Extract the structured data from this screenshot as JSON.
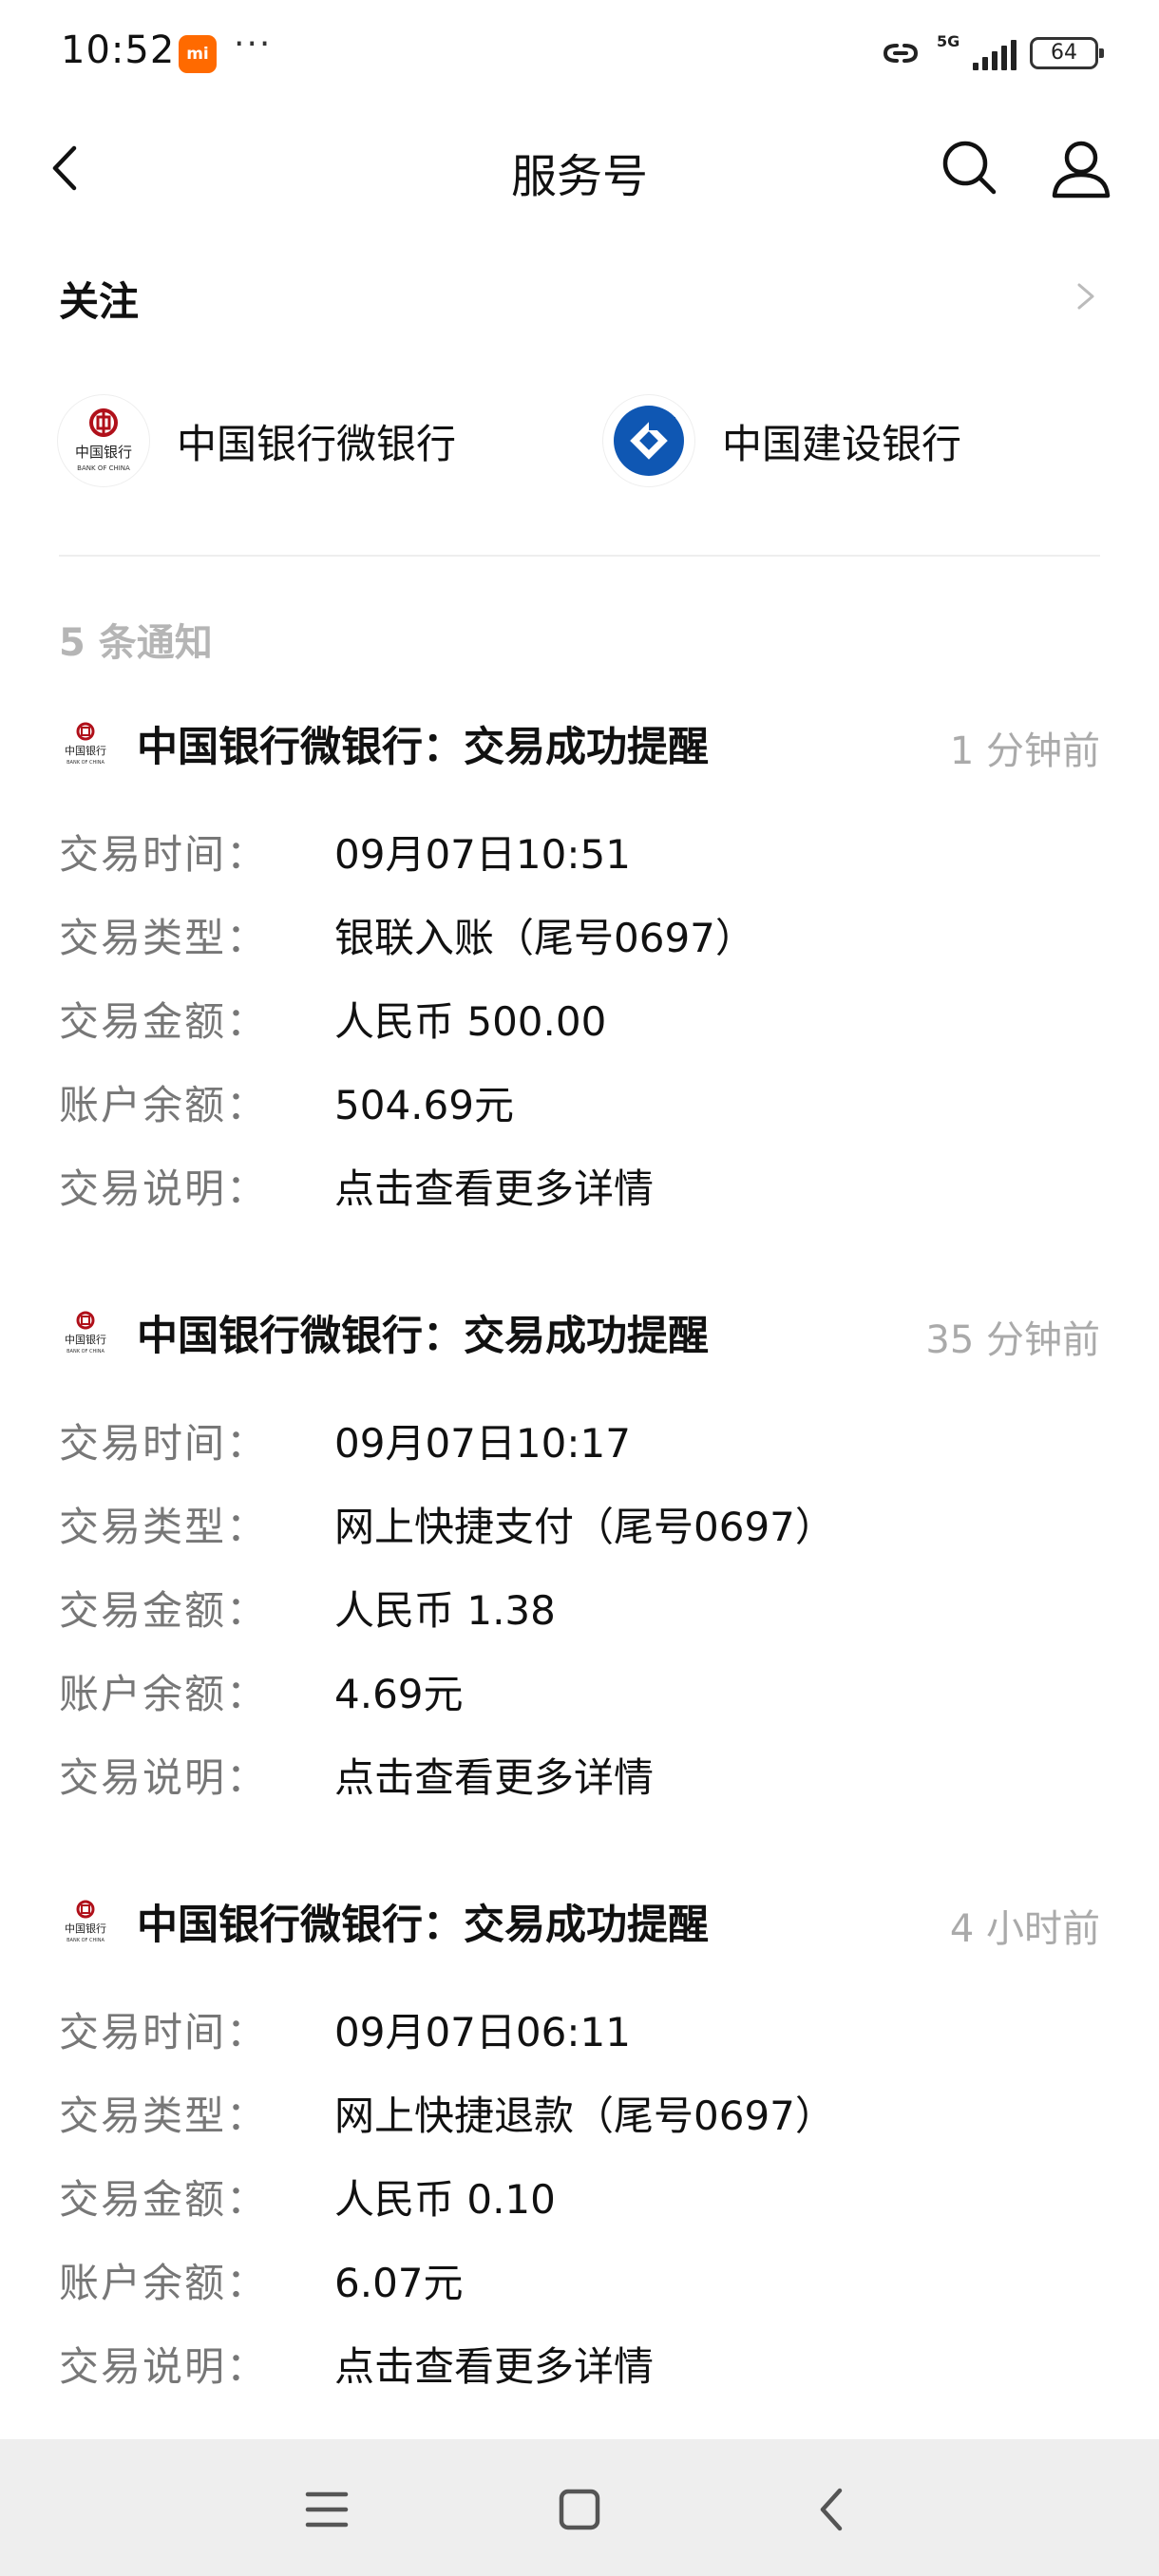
{
  "status_bar": {
    "time": "10:52",
    "mi_badge": "mi",
    "dots": "···",
    "network": "5G",
    "battery": "64"
  },
  "header": {
    "title": "服务号"
  },
  "follow": {
    "title": "关注",
    "accounts": [
      {
        "name": "中国银行微银行",
        "logo": "boc-logo",
        "brand_color": "#b0101a"
      },
      {
        "name": "中国建设银行",
        "logo": "ccb-logo",
        "brand_color": "#0f57b3"
      }
    ]
  },
  "notice_count": "5 条通知",
  "notifications": [
    {
      "title": "中国银行微银行：交易成功提醒",
      "time": "1 分钟前",
      "rows": [
        {
          "k": "交易时间：",
          "v": "09月07日10:51"
        },
        {
          "k": "交易类型：",
          "v": "银联入账（尾号0697）"
        },
        {
          "k": "交易金额：",
          "v": "人民币 500.00"
        },
        {
          "k": "账户余额：",
          "v": "504.69元"
        },
        {
          "k": "交易说明：",
          "v": "点击查看更多详情"
        }
      ]
    },
    {
      "title": "中国银行微银行：交易成功提醒",
      "time": "35 分钟前",
      "rows": [
        {
          "k": "交易时间：",
          "v": "09月07日10:17"
        },
        {
          "k": "交易类型：",
          "v": "网上快捷支付（尾号0697）"
        },
        {
          "k": "交易金额：",
          "v": "人民币 1.38"
        },
        {
          "k": "账户余额：",
          "v": "4.69元"
        },
        {
          "k": "交易说明：",
          "v": "点击查看更多详情"
        }
      ]
    },
    {
      "title": "中国银行微银行：交易成功提醒",
      "time": "4 小时前",
      "rows": [
        {
          "k": "交易时间：",
          "v": "09月07日06:11"
        },
        {
          "k": "交易类型：",
          "v": "网上快捷退款（尾号0697）"
        },
        {
          "k": "交易金额：",
          "v": "人民币 0.10"
        },
        {
          "k": "账户余额：",
          "v": "6.07元"
        },
        {
          "k": "交易说明：",
          "v": "点击查看更多详情"
        }
      ]
    }
  ],
  "nav": {
    "icons": [
      "menu-icon",
      "home-icon",
      "back-icon"
    ]
  }
}
